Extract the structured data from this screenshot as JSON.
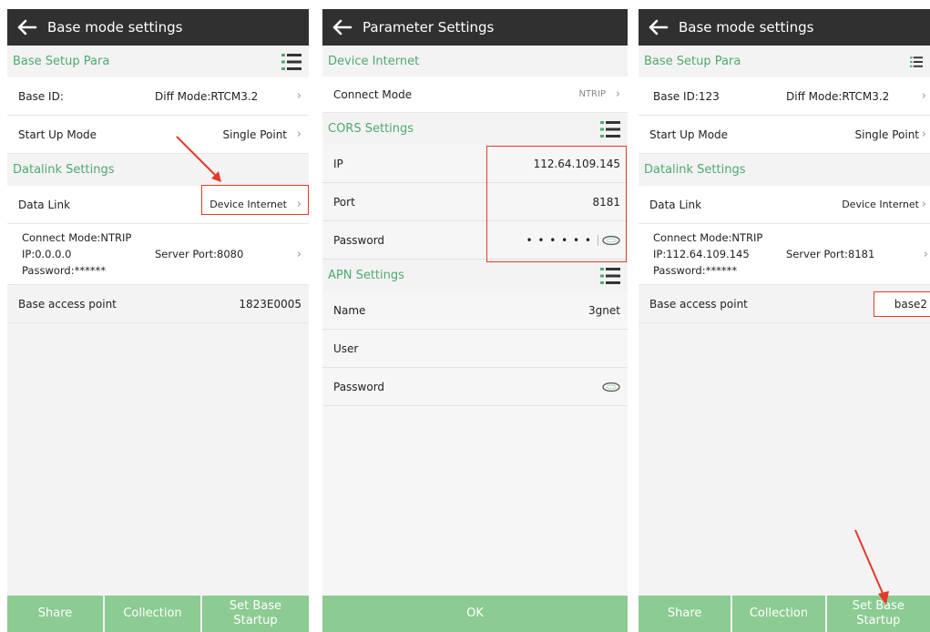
{
  "screen1": {
    "title": "Base mode settings",
    "base_setup_header": "Base Setup Para",
    "base_id_label": "Base ID:",
    "diff_mode": "Diff Mode:RTCM3.2",
    "startup_label": "Start Up Mode",
    "startup_value": "Single Point",
    "datalink_header": "Datalink Settings",
    "data_link_label": "Data Link",
    "data_link_value": "Device Internet",
    "connect_mode": "Connect Mode:NTRIP",
    "ip": "IP:0.0.0.0",
    "server_port": "Server Port:8080",
    "password": "Password:******",
    "base_access_label": "Base access point",
    "base_access_value": "1823E0005",
    "btn_share": "Share",
    "btn_collection": "Collection",
    "btn_set_base": "Set Base Startup"
  },
  "screen2": {
    "title": "Parameter Settings",
    "device_internet_header": "Device Internet",
    "connect_mode_label": "Connect Mode",
    "connect_mode_value": "NTRIP",
    "cors_header": "CORS Settings",
    "ip_label": "IP",
    "ip_value": "112.64.109.145",
    "port_label": "Port",
    "port_value": "8181",
    "password_label": "Password",
    "password_dots": "• • • • • •",
    "apn_header": "APN Settings",
    "name_label": "Name",
    "name_value": "3gnet",
    "user_label": "User",
    "apn_password_label": "Password",
    "btn_ok": "OK"
  },
  "screen3": {
    "title": "Base mode settings",
    "base_setup_header": "Base Setup Para",
    "base_id_label": "Base ID:123",
    "diff_mode": "Diff Mode:RTCM3.2",
    "startup_label": "Start Up Mode",
    "startup_value": "Single Point",
    "datalink_header": "Datalink Settings",
    "data_link_label": "Data Link",
    "data_link_value": "Device Internet",
    "connect_mode": "Connect Mode:NTRIP",
    "ip": "IP:112.64.109.145",
    "server_port": "Server Port:8181",
    "password": "Password:******",
    "base_access_label": "Base access point",
    "base_access_value": "base2",
    "btn_share": "Share",
    "btn_collection": "Collection",
    "btn_set_base": "Set Base Startup"
  },
  "colors": {
    "appbar": "#303030",
    "section_text": "#4eaa6f",
    "button": "#8ccb92",
    "annotation": "#e23a2a"
  },
  "icons": [
    "back-arrow-icon",
    "list-menu-icon",
    "chevron-right-icon",
    "eye-icon"
  ]
}
